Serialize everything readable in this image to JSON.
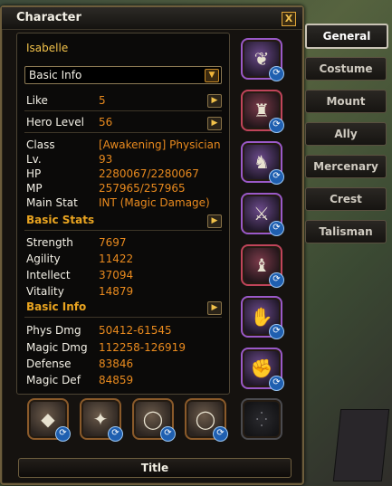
{
  "window": {
    "title": "Character",
    "close_label": "X"
  },
  "character": {
    "name": "Isabelle"
  },
  "dropdown": {
    "value": "Basic Info"
  },
  "info_rows": [
    {
      "label": "Like",
      "value": "5"
    },
    {
      "label": "Hero Level",
      "value": "56"
    }
  ],
  "details": [
    {
      "label": "Class",
      "value": "[Awakening] Physician"
    },
    {
      "label": "Lv.",
      "value": "93"
    },
    {
      "label": "HP",
      "value": "2280067/2280067"
    },
    {
      "label": "MP",
      "value": "257965/257965"
    },
    {
      "label": "Main Stat",
      "value": "INT (Magic Damage)"
    }
  ],
  "sections": {
    "basic_stats": "Basic Stats",
    "basic_info": "Basic Info"
  },
  "stats": [
    {
      "label": "Strength",
      "value": "7697"
    },
    {
      "label": "Agility",
      "value": "11422"
    },
    {
      "label": "Intellect",
      "value": "37094"
    },
    {
      "label": "Vitality",
      "value": "14879"
    }
  ],
  "combat": [
    {
      "label": "Phys Dmg",
      "value": "50412-61545"
    },
    {
      "label": "Magic Dmg",
      "value": "112258-126919"
    },
    {
      "label": "Defense",
      "value": "83846"
    },
    {
      "label": "Magic Def",
      "value": "84859"
    }
  ],
  "title_button": "Title",
  "side_tabs": [
    "General",
    "Costume",
    "Mount",
    "Ally",
    "Mercenary",
    "Crest",
    "Talisman"
  ],
  "icons": {
    "close": "close-icon",
    "dropdown": "chevron-down-icon",
    "expand": "chevron-right-icon",
    "swap": "swap-icon"
  }
}
